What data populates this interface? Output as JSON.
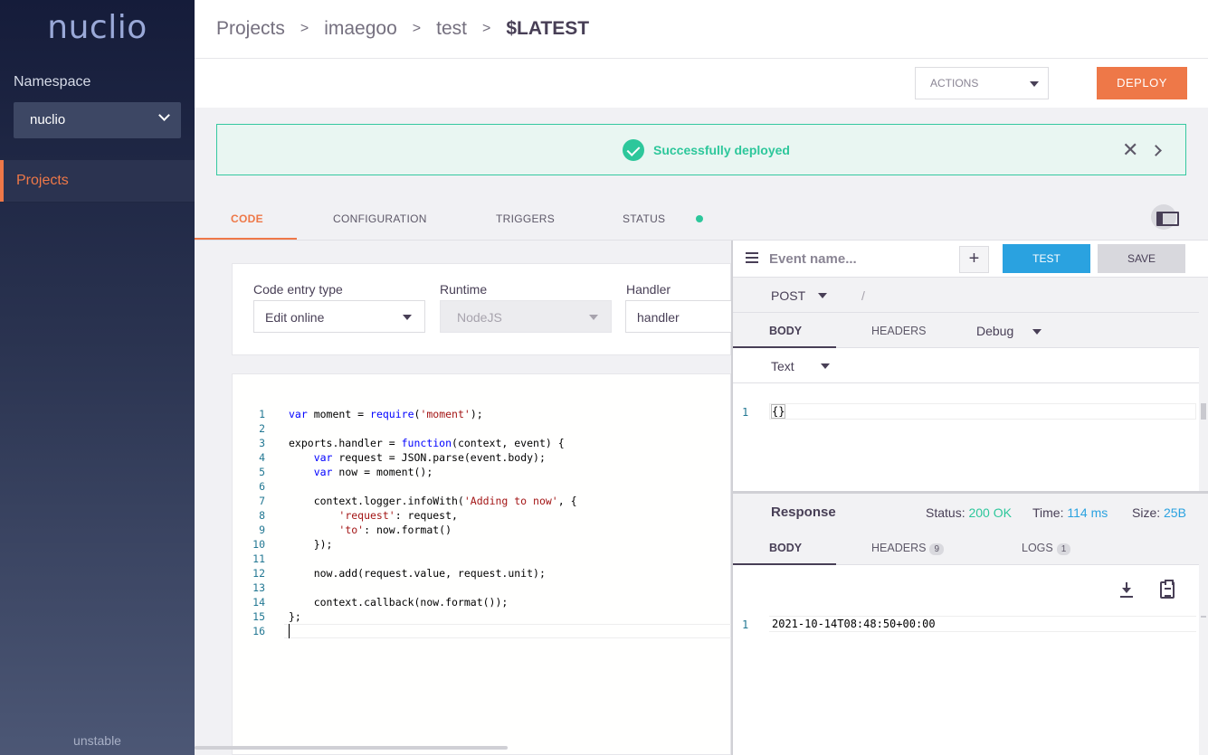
{
  "app": {
    "logo": "nuclio",
    "version": "unstable"
  },
  "sidebar": {
    "namespace_label": "Namespace",
    "namespace_value": "nuclio",
    "items": [
      {
        "label": "Projects",
        "active": true
      }
    ]
  },
  "breadcrumb": [
    "Projects",
    "imaegoo",
    "test",
    "$LATEST"
  ],
  "toolbar": {
    "actions_label": "ACTIONS",
    "deploy_label": "DEPLOY"
  },
  "alert": {
    "message": "Successfully deployed",
    "close_glyph": "✕"
  },
  "tabs": [
    "CODE",
    "CONFIGURATION",
    "TRIGGERS",
    "STATUS"
  ],
  "status_color": "#2dc79b",
  "code_entry": {
    "entry_type_label": "Code entry type",
    "entry_type_value": "Edit online",
    "runtime_label": "Runtime",
    "runtime_value": "NodeJS",
    "handler_label": "Handler",
    "handler_value": "handler"
  },
  "code_lines": [
    "var moment = require('moment');",
    "",
    "exports.handler = function(context, event) {",
    "    var request = JSON.parse(event.body);",
    "    var now = moment();",
    "",
    "    context.logger.infoWith('Adding to now', {",
    "        'request': request,",
    "        'to': now.format()",
    "    });",
    "",
    "    now.add(request.value, request.unit);",
    "",
    "    context.callback(now.format());",
    "};",
    ""
  ],
  "test_panel": {
    "event_placeholder": "Event name...",
    "plus_label": "+",
    "test_label": "TEST",
    "save_label": "SAVE",
    "method": "POST",
    "path": "/",
    "request_tabs": {
      "body": "BODY",
      "headers": "HEADERS",
      "log_level": "Debug"
    },
    "content_type": "Text",
    "body_line_number": "1",
    "body_value": "{}",
    "response": {
      "title": "Response",
      "status_label": "Status:",
      "status_value": "200 OK",
      "time_label": "Time:",
      "time_value": "114 ms",
      "size_label": "Size:",
      "size_value": "25B",
      "tabs": {
        "body": "BODY",
        "headers": "HEADERS",
        "headers_count": "9",
        "logs": "LOGS",
        "logs_count": "1"
      },
      "line_number": "1",
      "body": "2021-10-14T08:48:50+00:00"
    }
  }
}
